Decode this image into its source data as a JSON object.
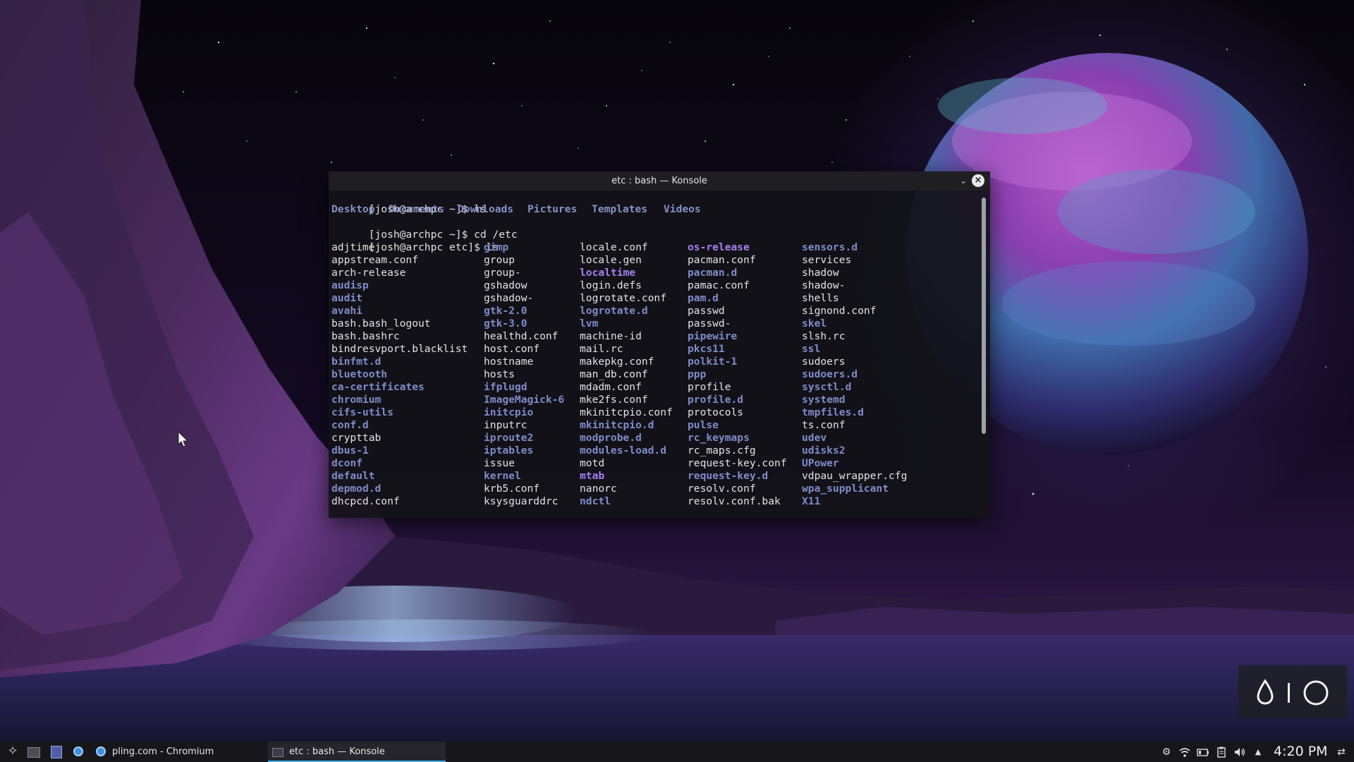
{
  "window": {
    "title": "etc : bash — Konsole",
    "collapse_icon": "chevron-down-icon",
    "close_icon": "close-icon"
  },
  "terminal": {
    "prompt_home": "[josh@archpc ~]$",
    "prompt_etc": "[josh@archpc etc]$",
    "cmd_ls": "ls",
    "cmd_cd": "cd /etc",
    "home_entries": [
      "Desktop",
      "Documents",
      "Downloads",
      "Pictures",
      "Templates",
      "Videos"
    ],
    "etc_columns": [
      [
        {
          "n": "adjtime",
          "t": "file"
        },
        {
          "n": "appstream.conf",
          "t": "file"
        },
        {
          "n": "arch-release",
          "t": "file"
        },
        {
          "n": "audisp",
          "t": "dir"
        },
        {
          "n": "audit",
          "t": "dir"
        },
        {
          "n": "avahi",
          "t": "dir"
        },
        {
          "n": "bash.bash_logout",
          "t": "file"
        },
        {
          "n": "bash.bashrc",
          "t": "file"
        },
        {
          "n": "bindresvport.blacklist",
          "t": "file"
        },
        {
          "n": "binfmt.d",
          "t": "dir"
        },
        {
          "n": "bluetooth",
          "t": "dir"
        },
        {
          "n": "ca-certificates",
          "t": "dir"
        },
        {
          "n": "chromium",
          "t": "dir"
        },
        {
          "n": "cifs-utils",
          "t": "dir"
        },
        {
          "n": "conf.d",
          "t": "dir"
        },
        {
          "n": "crypttab",
          "t": "file"
        },
        {
          "n": "dbus-1",
          "t": "dir"
        },
        {
          "n": "dconf",
          "t": "dir"
        },
        {
          "n": "default",
          "t": "dir"
        },
        {
          "n": "depmod.d",
          "t": "dir"
        },
        {
          "n": "dhcpcd.conf",
          "t": "file"
        }
      ],
      [
        {
          "n": "gimp",
          "t": "dir"
        },
        {
          "n": "group",
          "t": "file"
        },
        {
          "n": "group-",
          "t": "file"
        },
        {
          "n": "gshadow",
          "t": "file"
        },
        {
          "n": "gshadow-",
          "t": "file"
        },
        {
          "n": "gtk-2.0",
          "t": "dir"
        },
        {
          "n": "gtk-3.0",
          "t": "dir"
        },
        {
          "n": "healthd.conf",
          "t": "file"
        },
        {
          "n": "host.conf",
          "t": "file"
        },
        {
          "n": "hostname",
          "t": "file"
        },
        {
          "n": "hosts",
          "t": "file"
        },
        {
          "n": "ifplugd",
          "t": "dir"
        },
        {
          "n": "ImageMagick-6",
          "t": "dir"
        },
        {
          "n": "initcpio",
          "t": "dir"
        },
        {
          "n": "inputrc",
          "t": "file"
        },
        {
          "n": "iproute2",
          "t": "dir"
        },
        {
          "n": "iptables",
          "t": "dir"
        },
        {
          "n": "issue",
          "t": "file"
        },
        {
          "n": "kernel",
          "t": "dir"
        },
        {
          "n": "krb5.conf",
          "t": "file"
        },
        {
          "n": "ksysguarddrc",
          "t": "file"
        }
      ],
      [
        {
          "n": "locale.conf",
          "t": "file"
        },
        {
          "n": "locale.gen",
          "t": "file"
        },
        {
          "n": "localtime",
          "t": "link"
        },
        {
          "n": "login.defs",
          "t": "file"
        },
        {
          "n": "logrotate.conf",
          "t": "file"
        },
        {
          "n": "logrotate.d",
          "t": "dir"
        },
        {
          "n": "lvm",
          "t": "dir"
        },
        {
          "n": "machine-id",
          "t": "file"
        },
        {
          "n": "mail.rc",
          "t": "file"
        },
        {
          "n": "makepkg.conf",
          "t": "file"
        },
        {
          "n": "man_db.conf",
          "t": "file"
        },
        {
          "n": "mdadm.conf",
          "t": "file"
        },
        {
          "n": "mke2fs.conf",
          "t": "file"
        },
        {
          "n": "mkinitcpio.conf",
          "t": "file"
        },
        {
          "n": "mkinitcpio.d",
          "t": "dir"
        },
        {
          "n": "modprobe.d",
          "t": "dir"
        },
        {
          "n": "modules-load.d",
          "t": "dir"
        },
        {
          "n": "motd",
          "t": "file"
        },
        {
          "n": "mtab",
          "t": "link"
        },
        {
          "n": "nanorc",
          "t": "file"
        },
        {
          "n": "ndctl",
          "t": "dir"
        }
      ],
      [
        {
          "n": "os-release",
          "t": "link"
        },
        {
          "n": "pacman.conf",
          "t": "file"
        },
        {
          "n": "pacman.d",
          "t": "dir"
        },
        {
          "n": "pamac.conf",
          "t": "file"
        },
        {
          "n": "pam.d",
          "t": "dir"
        },
        {
          "n": "passwd",
          "t": "file"
        },
        {
          "n": "passwd-",
          "t": "file"
        },
        {
          "n": "pipewire",
          "t": "dir"
        },
        {
          "n": "pkcs11",
          "t": "dir"
        },
        {
          "n": "polkit-1",
          "t": "dir"
        },
        {
          "n": "ppp",
          "t": "dir"
        },
        {
          "n": "profile",
          "t": "file"
        },
        {
          "n": "profile.d",
          "t": "dir"
        },
        {
          "n": "protocols",
          "t": "file"
        },
        {
          "n": "pulse",
          "t": "dir"
        },
        {
          "n": "rc_keymaps",
          "t": "dir"
        },
        {
          "n": "rc_maps.cfg",
          "t": "file"
        },
        {
          "n": "request-key.conf",
          "t": "file"
        },
        {
          "n": "request-key.d",
          "t": "dir"
        },
        {
          "n": "resolv.conf",
          "t": "file"
        },
        {
          "n": "resolv.conf.bak",
          "t": "file"
        }
      ],
      [
        {
          "n": "sensors.d",
          "t": "dir"
        },
        {
          "n": "services",
          "t": "file"
        },
        {
          "n": "shadow",
          "t": "file"
        },
        {
          "n": "shadow-",
          "t": "file"
        },
        {
          "n": "shells",
          "t": "file"
        },
        {
          "n": "signond.conf",
          "t": "file"
        },
        {
          "n": "skel",
          "t": "dir"
        },
        {
          "n": "slsh.rc",
          "t": "file"
        },
        {
          "n": "ssl",
          "t": "dir"
        },
        {
          "n": "sudoers",
          "t": "file"
        },
        {
          "n": "sudoers.d",
          "t": "dir"
        },
        {
          "n": "sysctl.d",
          "t": "dir"
        },
        {
          "n": "systemd",
          "t": "dir"
        },
        {
          "n": "tmpfiles.d",
          "t": "dir"
        },
        {
          "n": "ts.conf",
          "t": "file"
        },
        {
          "n": "udev",
          "t": "dir"
        },
        {
          "n": "udisks2",
          "t": "dir"
        },
        {
          "n": "UPower",
          "t": "dir"
        },
        {
          "n": "vdpau_wrapper.cfg",
          "t": "file"
        },
        {
          "n": "wpa_supplicant",
          "t": "dir"
        },
        {
          "n": "X11",
          "t": "dir"
        }
      ]
    ],
    "colors": {
      "file": "#e3e3e3",
      "dir": "#7f8cc9",
      "link": "#a77ff0"
    }
  },
  "taskbar": {
    "launcher_icon": "kde-launcher-icon",
    "tasks": [
      {
        "label": "pling.com - Chromium",
        "icon": "chromium-icon"
      },
      {
        "label": "etc : bash — Konsole",
        "icon": "terminal-icon"
      }
    ],
    "clock": "4:20 PM",
    "tray_icons": [
      "settings-icon",
      "wifi-icon",
      "battery-icon",
      "clipboard-icon",
      "volume-icon",
      "expand-arrow-icon",
      "panel-menu-icon"
    ]
  },
  "widget": {
    "icons": [
      "drop-icon",
      "circle-icon"
    ]
  }
}
